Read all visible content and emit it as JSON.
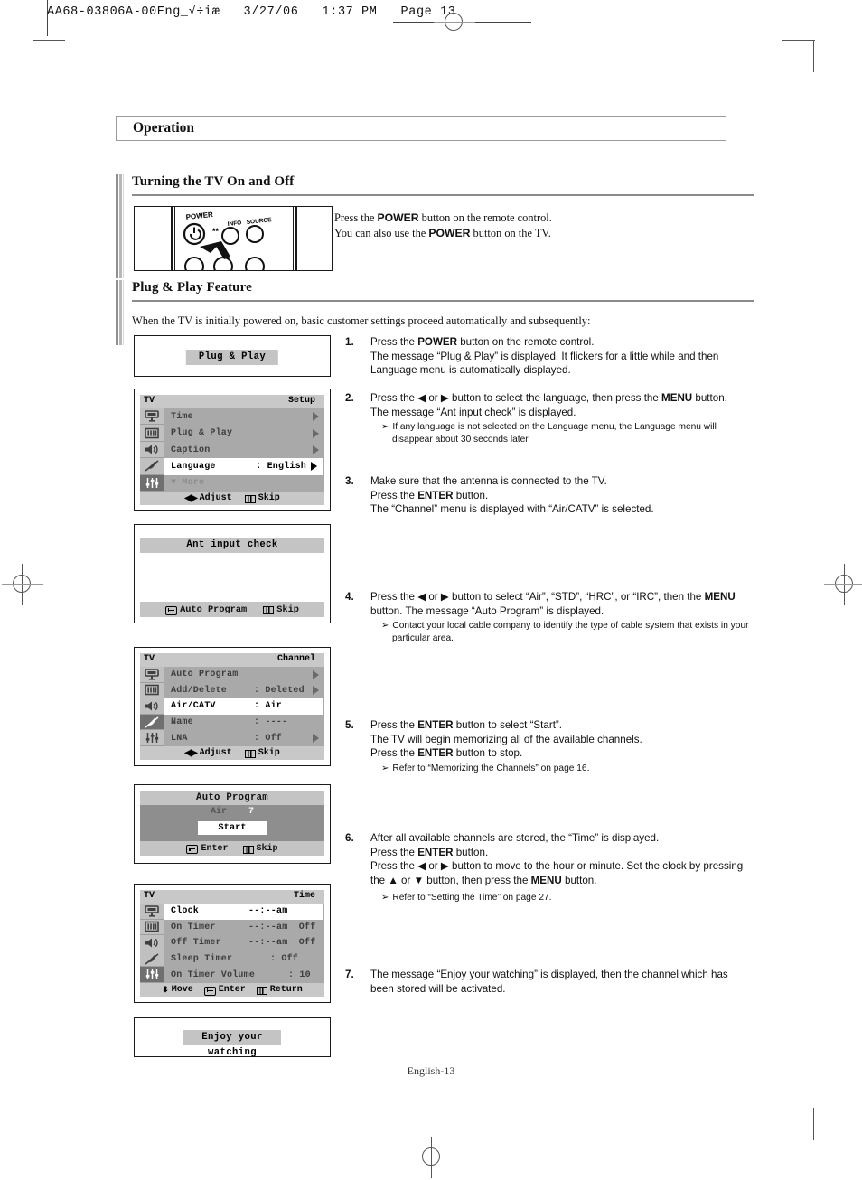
{
  "slug": {
    "text": "AA68-03806A-00Eng_√÷iæ   3/27/06   1:37 PM   Page 13"
  },
  "chapter": {
    "title": "Operation"
  },
  "sections": [
    {
      "title": "Turning the TV On and Off",
      "body_line1_pre": "Press the ",
      "body_line1_bold": "POWER",
      "body_line1_post": " button on the remote control.",
      "body_line2_pre": "You can also use the ",
      "body_line2_bold": "POWER",
      "body_line2_post": " button on the TV.",
      "remote_labels": {
        "power": "POWER",
        "info": "INFO",
        "source": "SOURCE"
      }
    },
    {
      "title": "Plug & Play Feature",
      "intro": "When the TV is initially powered on, basic customer settings proceed automatically and subsequently:"
    }
  ],
  "steps": [
    {
      "num": "1.",
      "lines": [
        "Press the POWER button on the remote control.",
        "The message “Plug & Play” is displayed. It flickers for a little while and then Language menu is automatically displayed."
      ],
      "notes": []
    },
    {
      "num": "2.",
      "lines": [
        "Press the ◄ or ► button to select the language, then press the MENU button.",
        "The message “Ant input check” is displayed."
      ],
      "notes": [
        "If any language is not selected on the Language menu, the Language menu will disappear about 30 seconds later."
      ]
    },
    {
      "num": "3.",
      "lines": [
        "Make sure that the antenna is connected to the TV.",
        "Press the ENTER button.",
        "The “Channel” menu is displayed with “Air/CATV” is selected."
      ],
      "notes": []
    },
    {
      "num": "4.",
      "lines": [
        "Press the ◄ or ► button to select “Air”, “STD”, “HRC”, or “IRC”, then the MENU button. The message “Auto Program” is displayed."
      ],
      "notes": [
        "Contact your local cable company to identify the type of cable system that exists in your particular area."
      ]
    },
    {
      "num": "5.",
      "lines": [
        "Press the ENTER button to select “Start”.",
        "The TV will begin memorizing all of the available channels.",
        "Press the ENTER button to stop."
      ],
      "notes": [
        "Refer to “Memorizing the Channels” on page 16."
      ]
    },
    {
      "num": "6.",
      "lines": [
        "After all available channels are stored, the “Time” is displayed.",
        "Press the ENTER button.",
        "Press the ◄ or ► button to move to the hour or minute. Set the clock by pressing the ▲ or ▼ button, then press the MENU button."
      ],
      "notes": [
        "Refer to “Setting the Time” on page 27."
      ]
    },
    {
      "num": "7.",
      "lines": [
        "The message “Enjoy your watching” is displayed, then the channel which has been stored will be activated."
      ],
      "notes": []
    }
  ],
  "osd": {
    "plug_play_msg": "Plug & Play",
    "setup_menu": {
      "tv": "TV",
      "title": "Setup",
      "rows": [
        {
          "label": "Time",
          "value": "",
          "arrow": true,
          "selected": false,
          "dim": false
        },
        {
          "label": "Plug & Play",
          "value": "",
          "arrow": true,
          "selected": false,
          "dim": false
        },
        {
          "label": "Caption",
          "value": "",
          "arrow": true,
          "selected": false,
          "dim": false
        },
        {
          "label": "Language",
          "value": ": English",
          "arrow": true,
          "selected": true,
          "dim": false
        },
        {
          "label": "▼ More",
          "value": "",
          "arrow": false,
          "selected": false,
          "dim": true
        }
      ],
      "footer": [
        {
          "glyph": "left-right",
          "label": "Adjust"
        },
        {
          "glyph": "menu",
          "label": "Skip"
        }
      ]
    },
    "ant_check": {
      "message": "Ant input check",
      "footer": [
        {
          "glyph": "enter",
          "label": "Auto Program"
        },
        {
          "glyph": "menu",
          "label": "Skip"
        }
      ]
    },
    "channel_menu": {
      "tv": "TV",
      "title": "Channel",
      "rows": [
        {
          "label": "Auto Program",
          "value": "",
          "arrow": true,
          "selected": false,
          "dim": false
        },
        {
          "label": "Add/Delete",
          "value": ": Deleted",
          "arrow": true,
          "selected": false,
          "dim": false
        },
        {
          "label": "Air/CATV",
          "value": ": Air",
          "arrow": false,
          "selected": true,
          "dim": false
        },
        {
          "label": "Name",
          "value": ": ----",
          "arrow": false,
          "selected": false,
          "dim": false
        },
        {
          "label": "LNA",
          "value": ": Off",
          "arrow": true,
          "selected": false,
          "dim": false
        }
      ],
      "footer": [
        {
          "glyph": "left-right",
          "label": "Adjust"
        },
        {
          "glyph": "menu",
          "label": "Skip"
        }
      ]
    },
    "auto_program": {
      "title": "Auto Program",
      "air_label": "Air",
      "air_value": "7",
      "start_label": "Start",
      "footer": [
        {
          "glyph": "enter",
          "label": "Enter"
        },
        {
          "glyph": "menu",
          "label": "Skip"
        }
      ]
    },
    "time_menu": {
      "tv": "TV",
      "title": "Time",
      "rows": [
        {
          "label": "Clock",
          "value": "--:--am",
          "arrow": false,
          "selected": true,
          "dim": false
        },
        {
          "label": "On Timer",
          "value": "--:--am  Off",
          "arrow": false,
          "selected": false,
          "dim": false
        },
        {
          "label": "Off Timer",
          "value": "--:--am  Off",
          "arrow": false,
          "selected": false,
          "dim": false
        },
        {
          "label": "Sleep Timer",
          "value": ": Off",
          "arrow": false,
          "selected": false,
          "dim": false
        },
        {
          "label": "On Timer Volume",
          "value": ": 10",
          "arrow": false,
          "selected": false,
          "dim": false
        }
      ],
      "footer": [
        {
          "glyph": "up-down",
          "label": "Move"
        },
        {
          "glyph": "enter",
          "label": "Enter"
        },
        {
          "glyph": "menu",
          "label": "Return"
        }
      ]
    },
    "enjoy_msg": "Enjoy your watching"
  },
  "footer": {
    "page_label": "English-13"
  },
  "colors": {
    "osd_bg": "#a9a9a9",
    "osd_header": "#c8c8c8",
    "osd_selected": "#ffffff",
    "osd_icon_active": "#6f6f6f",
    "rule": "#8a8a8a"
  }
}
